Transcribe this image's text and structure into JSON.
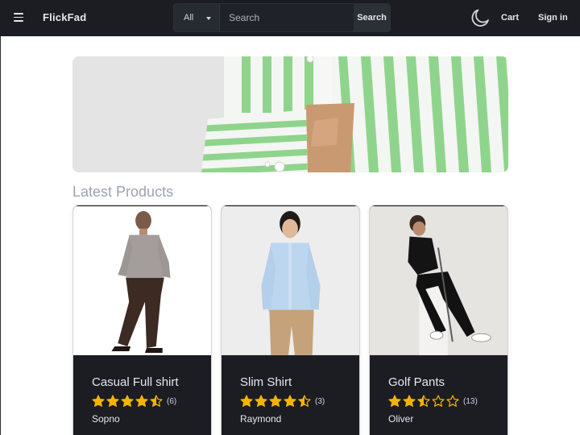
{
  "header": {
    "brand": "FlickFad",
    "search": {
      "category": "All",
      "placeholder": "Search",
      "button_label": "Search"
    },
    "cart_label": "Cart",
    "signin_label": "Sign in"
  },
  "main": {
    "section_title": "Latest Products",
    "products": [
      {
        "title": "Casual Full shirt",
        "rating": 4.5,
        "reviews": "(6)",
        "seller": "Sopno"
      },
      {
        "title": "Slim Shirt",
        "rating": 4.5,
        "reviews": "(3)",
        "seller": "Raymond"
      },
      {
        "title": "Golf Pants",
        "rating": 2.5,
        "reviews": "(13)",
        "seller": "Oliver"
      }
    ]
  },
  "colors": {
    "navbar": "#1b1d22",
    "star": "#f4b400",
    "card_body": "#1b1d22"
  },
  "icons": [
    "menu-icon",
    "chevron-down-icon",
    "moon-icon",
    "star-icon"
  ]
}
